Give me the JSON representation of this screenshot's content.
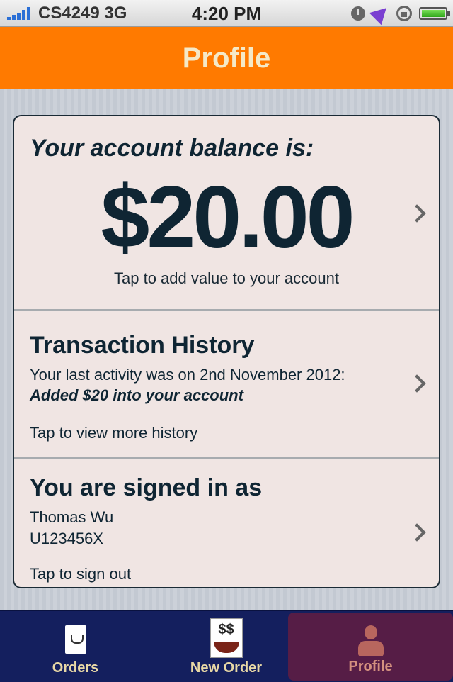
{
  "status_bar": {
    "carrier": "CS4249 3G",
    "time": "4:20 PM",
    "icons": [
      "signal-icon",
      "alarm-icon",
      "location-icon",
      "orientation-lock-icon",
      "battery-icon"
    ]
  },
  "nav": {
    "title": "Profile"
  },
  "balance": {
    "label": "Your account balance is:",
    "amount": "$20.00",
    "hint": "Tap to add value to your account"
  },
  "history": {
    "title": "Transaction History",
    "last_activity": "Your last activity was on 2nd November 2012:",
    "detail": "Added $20 into your account",
    "hint": "Tap to view more history"
  },
  "account": {
    "title": "You are signed in as",
    "name": "Thomas Wu",
    "user_id": "U123456X",
    "hint": "Tap to sign out"
  },
  "tabs": [
    {
      "label": "Orders",
      "icon": "document-icon",
      "selected": false
    },
    {
      "label": "New Order",
      "icon": "bowl-icon",
      "selected": false
    },
    {
      "label": "Profile",
      "icon": "person-icon",
      "selected": true
    }
  ],
  "colors": {
    "nav_background": "#ff7a00",
    "nav_title": "#f5e9c7",
    "tabbar_background": "#141f5e",
    "tab_selected": "#561d46",
    "text_dark": "#0f2533"
  }
}
